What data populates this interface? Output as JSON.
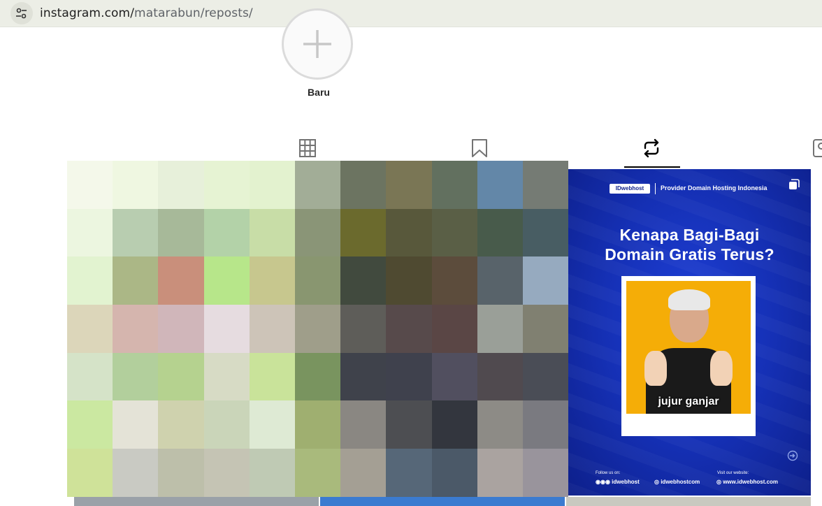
{
  "browser": {
    "url_domain": "instagram.com/",
    "url_path": "matarabun/reposts/",
    "site_info_icon": "tune-icon"
  },
  "highlight": {
    "new_label": "Baru",
    "icon": "plus-icon"
  },
  "tabs": [
    {
      "name": "posts",
      "icon": "grid-icon",
      "active": false
    },
    {
      "name": "saved",
      "icon": "bookmark-icon",
      "active": false
    },
    {
      "name": "reposts",
      "icon": "repost-icon",
      "active": true
    },
    {
      "name": "tagged",
      "icon": "tagged-icon",
      "active": false
    }
  ],
  "posts": {
    "promo": {
      "brand": "IDwebhost",
      "tagline": "Provider Domain Hosting Indonesia",
      "headline_line1": "Kenapa Bagi-Bagi",
      "headline_line2": "Domain Gratis Terus?",
      "caption": "jujur ganjar",
      "follow_label": "Follow us on:",
      "visit_label": "Visit our website:",
      "social_handle": "idwebhost",
      "instagram_handle": "idwebhostcom",
      "website": "www.idwebhost.com"
    }
  },
  "colors": {
    "promo_bg": "#1530b5",
    "photo_bg": "#f5ad07",
    "active_tab": "#000000"
  }
}
